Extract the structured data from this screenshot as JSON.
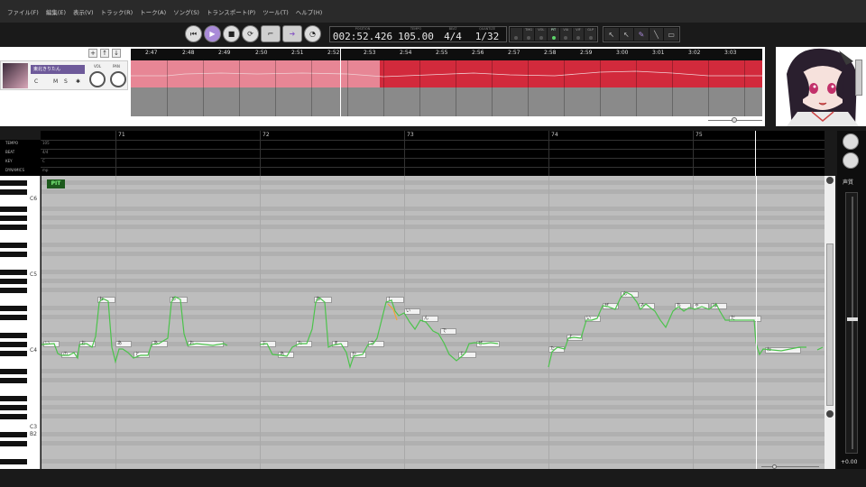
{
  "menu": [
    "ファイル(F)",
    "編集(E)",
    "表示(V)",
    "トラック(R)",
    "トーク(A)",
    "ソング(S)",
    "トランスポート(P)",
    "ツール(T)",
    "ヘルプ(H)"
  ],
  "display": {
    "position_caption": "POSITION",
    "position": "002:52.426",
    "tempo_caption": "TEMPO",
    "tempo": "105.00",
    "beat_caption": "BEAT",
    "beat": "4/4",
    "quantize_caption": "QUANTIZE",
    "quantize": "1/32"
  },
  "track_buttons": [
    "",
    "TMG",
    "VOL",
    "PIT",
    "VIA",
    "VIF",
    "GLP"
  ],
  "track_buttons_active": "PIT",
  "track": {
    "name": "東北きりたん",
    "c_label": "C",
    "m_label": "M",
    "s_label": "S",
    "vol_label": "VOL",
    "pan_label": "PAN"
  },
  "timeline_labels": [
    "2:47",
    "2:48",
    "2:49",
    "2:50",
    "2:51",
    "2:52",
    "2:53",
    "2:54",
    "2:55",
    "2:56",
    "2:57",
    "2:58",
    "2:59",
    "3:00",
    "3:01",
    "3:02",
    "3:03"
  ],
  "roll": {
    "row_labels": [
      "TEMPO",
      "BEAT",
      "KEY",
      "DYNAMICS"
    ],
    "row_values": [
      "105",
      "4/4",
      "C",
      "mp"
    ],
    "measures": [
      "71",
      "72",
      "73",
      "74",
      "75"
    ],
    "key_labels": [
      "C6",
      "C5",
      "C4",
      "C3",
      "B2"
    ],
    "mode_badge": "PIT"
  },
  "notes": [
    "い",
    "の",
    "お",
    "わ",
    "あ",
    "と",
    "あ",
    "め",
    "お",
    "ぶ",
    "あ",
    "た",
    "あ",
    "ま",
    "か",
    "さ",
    "し",
    "い",
    "ん",
    "で",
    "も",
    "ぜ",
    "た",
    "よ",
    "い",
    "ぜ",
    "ん",
    "み",
    "ち",
    "ゃ",
    "は",
    "だ",
    "わ"
  ],
  "side": {
    "voice_label": "声質",
    "gain": "+0.00"
  },
  "colors": {
    "track_red": "#d22a3c",
    "pitch_line": "#4cc34c",
    "accent": "#a98ad8"
  }
}
